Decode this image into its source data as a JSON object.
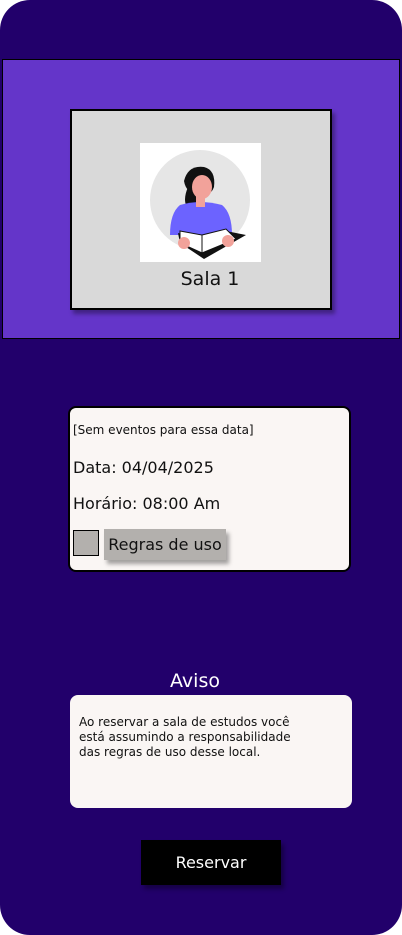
{
  "room": {
    "name": "Sala 1",
    "illustration_icon": "person-reading-book-icon"
  },
  "details": {
    "no_events": "[Sem eventos para essa data]",
    "date": "Data: 04/04/2025",
    "time": "Horário: 08:00 Am",
    "rules_label": "Regras de uso",
    "rules_checked": false
  },
  "notice": {
    "title": "Aviso",
    "text": "Ao reservar a sala de estudos você está assumindo a responsabilidade das regras de uso desse local."
  },
  "actions": {
    "reserve_label": "Reservar"
  },
  "colors": {
    "background": "#22006b",
    "hero": "#6435c9",
    "card": "#d9d9d9",
    "panel": "#faf6f4",
    "button": "#000000"
  }
}
